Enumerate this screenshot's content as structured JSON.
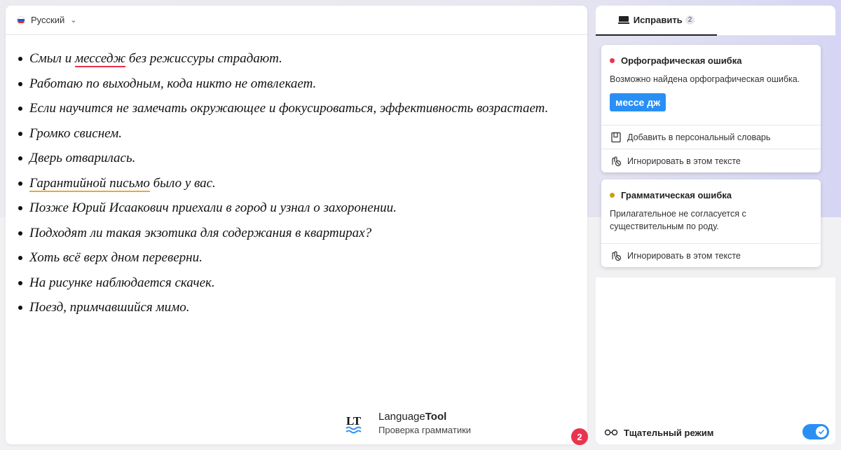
{
  "colors": {
    "spelling_error": "#e8344e",
    "grammar_error": "#e8a838",
    "accent_blue": "#2a8ff5",
    "grammar_dot": "#c9a10a"
  },
  "editor": {
    "language": {
      "label": "Русский",
      "flag_icon": "russia-flag-icon"
    },
    "sentences": [
      {
        "before": "Смыл и ",
        "error": "месседж",
        "error_type": "spelling",
        "after": " без режиссуры страдают."
      },
      {
        "before": "Работаю по выходным, кода никто не отвлекает.",
        "error": "",
        "error_type": "",
        "after": ""
      },
      {
        "before": "Если научится не замечать окружающее и фокусироваться, эффективность возрастает.",
        "error": "",
        "error_type": "",
        "after": ""
      },
      {
        "before": "Громко свиснем.",
        "error": "",
        "error_type": "",
        "after": ""
      },
      {
        "before": "Дверь отварилась.",
        "error": "",
        "error_type": "",
        "after": ""
      },
      {
        "before": "",
        "error": "Гарантийной письмо",
        "error_type": "grammar",
        "after": " было у вас."
      },
      {
        "before": "Позже Юрий Исаакович приехали в город и узнал о захоронении.",
        "error": "",
        "error_type": "",
        "after": ""
      },
      {
        "before": "Подходят ли такая экзотика для содержания в квартирах?",
        "error": "",
        "error_type": "",
        "after": ""
      },
      {
        "before": "Хоть всё верх дном переверни.",
        "error": "",
        "error_type": "",
        "after": ""
      },
      {
        "before": "На рисунке наблюдается скачек.",
        "error": "",
        "error_type": "",
        "after": ""
      },
      {
        "before": "Поезд, примчавшийся мимо.",
        "error": "",
        "error_type": "",
        "after": ""
      }
    ],
    "brand": {
      "name_regular": "Language",
      "name_bold": "Tool",
      "subtitle": "Проверка грамматики"
    },
    "error_count": "2"
  },
  "sidebar": {
    "tab": {
      "label": "Исправить",
      "count": "2",
      "icon": "keyboard-icon"
    },
    "cards": [
      {
        "title": "Орфографическая ошибка",
        "description": "Возможно найдена орфографическая ошибка.",
        "suggestion": "мессе дж",
        "actions": [
          {
            "label": "Добавить в персональный словарь",
            "icon": "dictionary-icon"
          },
          {
            "label": "Игнорировать в этом тексте",
            "icon": "ignore-icon"
          }
        ]
      },
      {
        "title": "Грамматическая ошибка",
        "description": "Прилагательное не согласуется с существительным по роду.",
        "actions": [
          {
            "label": "Игнорировать в этом тексте",
            "icon": "ignore-icon"
          }
        ]
      }
    ],
    "mode": {
      "label": "Тщательный режим",
      "icon": "glasses-icon",
      "enabled": true
    }
  }
}
